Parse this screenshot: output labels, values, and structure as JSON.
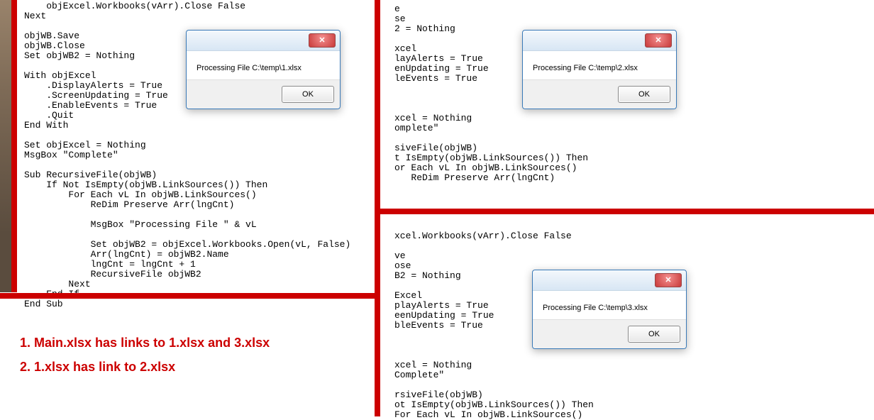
{
  "panes": {
    "p1_code": "    objExcel.Workbooks(vArr).Close False\nNext\n\nobjWB.Save\nobjWB.Close\nSet objWB2 = Nothing\n\nWith objExcel\n    .DisplayAlerts = True\n    .ScreenUpdating = True\n    .EnableEvents = True\n    .Quit\nEnd With\n\nSet objExcel = Nothing\nMsgBox \"Complete\"\n\nSub RecursiveFile(objWB)\n    If Not IsEmpty(objWB.LinkSources()) Then\n        For Each vL In objWB.LinkSources()\n            ReDim Preserve Arr(lngCnt)\n\n            MsgBox \"Processing File \" & vL\n\n            Set objWB2 = objExcel.Workbooks.Open(vL, False)\n            Arr(lngCnt) = objWB2.Name\n            lngCnt = lngCnt + 1\n            RecursiveFile objWB2\n        Next\n    End If\nEnd Sub",
    "p2_code": "e\nse\n2 = Nothing\n\nxcel\nlayAlerts = True\nenUpdating = True\nleEvents = True\n\n\n\nxcel = Nothing\nomplete\"\n\nsiveFile(objWB)\nt IsEmpty(objWB.LinkSources()) Then\nor Each vL In objWB.LinkSources()\n   ReDim Preserve Arr(lngCnt)\n",
    "p3_code": "xcel.Workbooks(vArr).Close False\n\nve\nose\nB2 = Nothing\n\nExcel\nplayAlerts = True\neenUpdating = True\nbleEvents = True\n\n\n\nxcel = Nothing\nComplete\"\n\nrsiveFile(objWB)\not IsEmpty(objWB.LinkSources()) Then\nFor Each vL In objWB.LinkSources()"
  },
  "dialogs": {
    "d1_msg": "Processing File C:\\temp\\1.xlsx",
    "d2_msg": "Processing File C:\\temp\\2.xlsx",
    "d3_msg": "Processing File C:\\temp\\3.xlsx",
    "ok": "OK"
  },
  "annotation": {
    "line1": "1. Main.xlsx has links to 1.xlsx and 3.xlsx",
    "line2": "2. 1.xlsx has link to 2.xlsx"
  }
}
